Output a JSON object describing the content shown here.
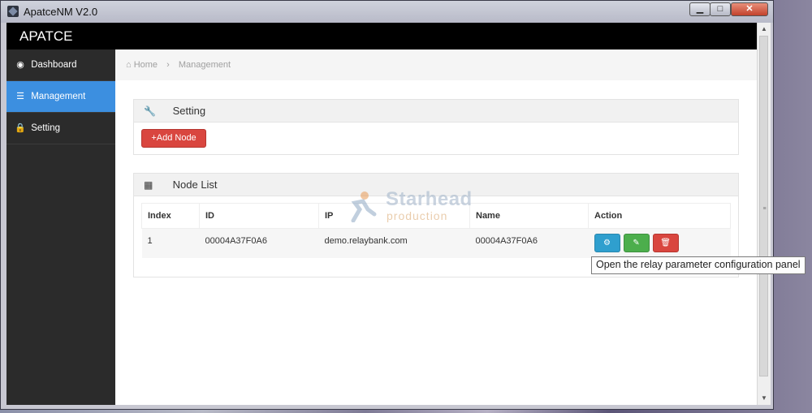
{
  "window": {
    "title": "ApatceNM V2.0",
    "min_label": "▁",
    "max_label": "□",
    "close_label": "✕"
  },
  "app": {
    "brand": "APATCE"
  },
  "sidebar": {
    "items": [
      {
        "label": "Dashboard",
        "icon": "dashboard-icon",
        "glyph": "◉",
        "active": false
      },
      {
        "label": "Management",
        "icon": "list-icon",
        "glyph": "☰",
        "active": true
      },
      {
        "label": "Setting",
        "icon": "lock-icon",
        "glyph": "🔒",
        "active": false
      }
    ]
  },
  "breadcrumb": {
    "home": "Home",
    "current": "Management"
  },
  "setting_panel": {
    "title": "Setting",
    "add_label": "Add Node"
  },
  "node_panel": {
    "title": "Node List",
    "columns": [
      "Index",
      "ID",
      "IP",
      "Name",
      "Action"
    ],
    "rows": [
      {
        "index": "1",
        "id": "00004A37F0A6",
        "ip": "demo.relaybank.com",
        "name": "00004A37F0A6"
      }
    ]
  },
  "tooltip": "Open the relay parameter configuration panel",
  "watermark": {
    "line1": "Starhead",
    "line2": "production"
  },
  "colors": {
    "accent": "#3c8fe0",
    "danger": "#d9463f",
    "success": "#4cae4c",
    "info": "#2f9fce"
  }
}
